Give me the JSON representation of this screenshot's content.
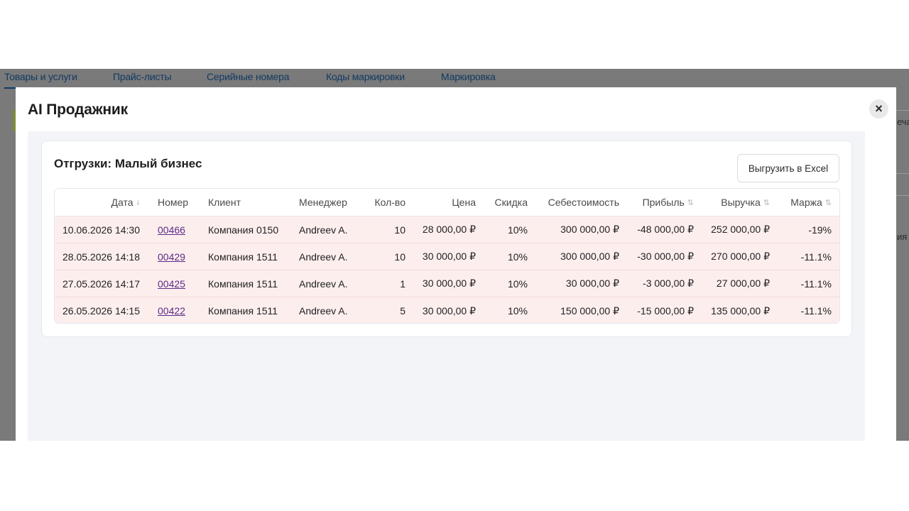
{
  "app": {
    "tabs": [
      "Товары и услуги",
      "Прайс-листы",
      "Серийные номера",
      "Коды маркировки",
      "Маркировка"
    ],
    "right_text_1": "еча",
    "right_text_2": "ия"
  },
  "modal": {
    "title": "AI Продажник",
    "close_icon": "×"
  },
  "card": {
    "title": "Отгрузки: Малый бизнес",
    "export_label": "Выгрузить в Excel"
  },
  "table": {
    "columns": [
      "Дата",
      "Номер",
      "Клиент",
      "Менеджер",
      "Кол-во",
      "Цена",
      "Скидка",
      "Себестоимость",
      "Прибыль",
      "Выручка",
      "Маржа"
    ],
    "sort_active_icon": "↓",
    "sort_icon": "⇅",
    "rows": [
      {
        "date": "10.06.2026 14:30",
        "number": "00466",
        "client": "Компания 0150",
        "manager": "Andreev A.",
        "qty": "10",
        "price": "28 000,00 ₽",
        "discount": "10%",
        "cost": "300 000,00 ₽",
        "profit": "-48 000,00 ₽",
        "revenue": "252 000,00 ₽",
        "margin": "-19%"
      },
      {
        "date": "28.05.2026 14:18",
        "number": "00429",
        "client": "Компания 1511",
        "manager": "Andreev A.",
        "qty": "10",
        "price": "30 000,00 ₽",
        "discount": "10%",
        "cost": "300 000,00 ₽",
        "profit": "-30 000,00 ₽",
        "revenue": "270 000,00 ₽",
        "margin": "-11.1%"
      },
      {
        "date": "27.05.2026 14:17",
        "number": "00425",
        "client": "Компания 1511",
        "manager": "Andreev A.",
        "qty": "1",
        "price": "30 000,00 ₽",
        "discount": "10%",
        "cost": "30 000,00 ₽",
        "profit": "-3 000,00 ₽",
        "revenue": "27 000,00 ₽",
        "margin": "-11.1%"
      },
      {
        "date": "26.05.2026 14:15",
        "number": "00422",
        "client": "Компания 1511",
        "manager": "Andreev A.",
        "qty": "5",
        "price": "30 000,00 ₽",
        "discount": "10%",
        "cost": "150 000,00 ₽",
        "profit": "-15 000,00 ₽",
        "revenue": "135 000,00 ₽",
        "margin": "-11.1%"
      }
    ]
  },
  "colors": {
    "row_highlight": "#fdeeee",
    "link": "#5b2a86",
    "overlay": "#7a7a7a"
  }
}
